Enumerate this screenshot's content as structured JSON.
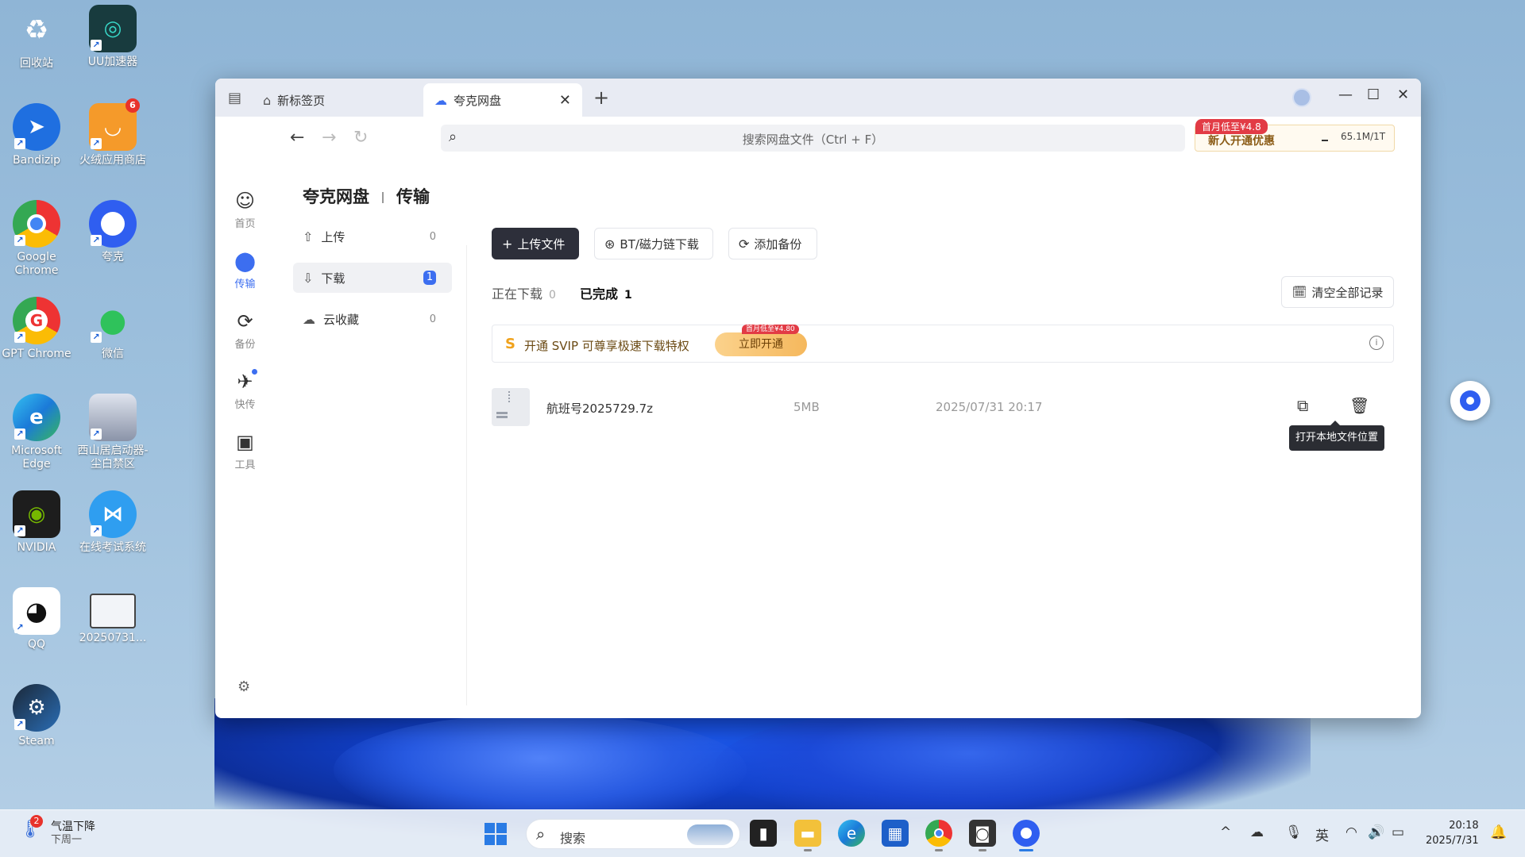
{
  "desktop": {
    "icons": [
      {
        "label": "回收站"
      },
      {
        "label": "UU加速器"
      },
      {
        "label": "Bandizip"
      },
      {
        "label": "火绒应用商店",
        "badge": "6"
      },
      {
        "label": "Google Chrome"
      },
      {
        "label": "夸克"
      },
      {
        "label": "GPT Chrome"
      },
      {
        "label": "微信"
      },
      {
        "label": "Microsoft Edge"
      },
      {
        "label": "西山居启动器-尘白禁区"
      },
      {
        "label": "NVIDIA"
      },
      {
        "label": "在线考试系统"
      },
      {
        "label": "QQ"
      },
      {
        "label": "20250731..."
      },
      {
        "label": "Steam"
      }
    ]
  },
  "browser": {
    "tabs": [
      {
        "label": "新标签页",
        "icon": "home-icon"
      },
      {
        "label": "夸克网盘",
        "icon": "cloud-icon"
      }
    ],
    "search_placeholder": "搜索网盘文件（Ctrl + F）",
    "promo": {
      "tag": "首月低至¥4.8",
      "text": "新人开通优惠",
      "quota": "65.1M/1T"
    }
  },
  "rail": [
    {
      "label": "首页",
      "icon": "home-face-icon"
    },
    {
      "label": "传输",
      "icon": "transfer-icon"
    },
    {
      "label": "备份",
      "icon": "backup-icon"
    },
    {
      "label": "快传",
      "icon": "send-icon"
    },
    {
      "label": "工具",
      "icon": "toolbox-icon"
    }
  ],
  "breadcrumb": {
    "root": "夸克网盘",
    "current": "传输"
  },
  "leftnav": [
    {
      "label": "上传",
      "count": "0"
    },
    {
      "label": "下载",
      "count": "1"
    },
    {
      "label": "云收藏",
      "count": "0"
    }
  ],
  "actions": {
    "upload": "上传文件",
    "bt": "BT/磁力链下载",
    "backup": "添加备份"
  },
  "subtabs": {
    "downloading": "正在下载",
    "downloading_count": "0",
    "done": "已完成",
    "done_count": "1"
  },
  "clear_all": "清空全部记录",
  "banner": {
    "text": "开通 SVIP 可尊享极速下载特权",
    "button": "立即开通",
    "tag": "首月低至¥4.80"
  },
  "file": {
    "name": "航班号2025729.7z",
    "size": "5MB",
    "date": "2025/07/31 20:17"
  },
  "tooltip": "打开本地文件位置",
  "taskbar": {
    "weather_title": "气温下降",
    "weather_sub": "下周一",
    "weather_badge": "2",
    "search": "搜索",
    "lang": "英",
    "time": "20:18",
    "date": "2025/7/31"
  }
}
